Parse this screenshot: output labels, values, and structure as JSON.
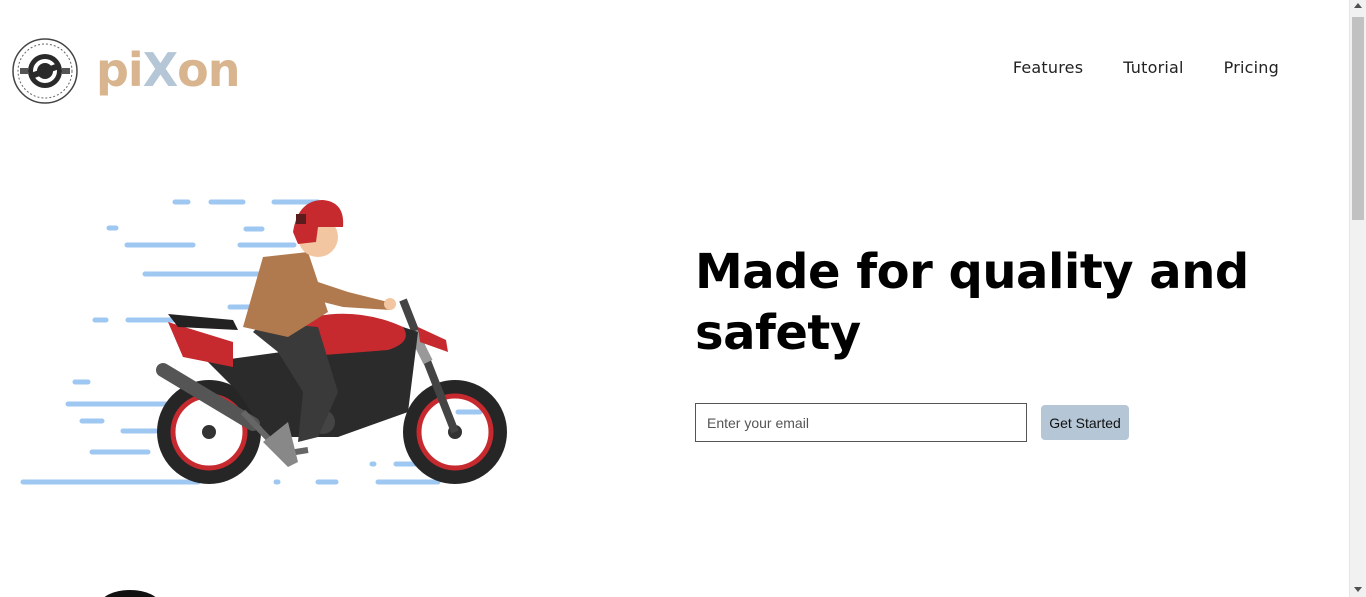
{
  "header": {
    "brand": {
      "part1": "pi",
      "part2": "X",
      "part3": "on"
    },
    "logo_icon": "motorcycle-seal-logo",
    "nav": [
      {
        "label": "Features"
      },
      {
        "label": "Tutorial"
      },
      {
        "label": "Pricing"
      }
    ]
  },
  "hero": {
    "title": "Made for quality and safety",
    "email_placeholder": "Enter your email",
    "cta_label": "Get Started",
    "illustration_icon": "motorcycle-rider-illustration"
  },
  "colors": {
    "brand_tan": "#d8b48f",
    "brand_blue": "#b5c6d6",
    "button_bg": "#b5c6d6",
    "speed_lines": "#9ec7f2",
    "bike_red": "#c62a2f"
  }
}
